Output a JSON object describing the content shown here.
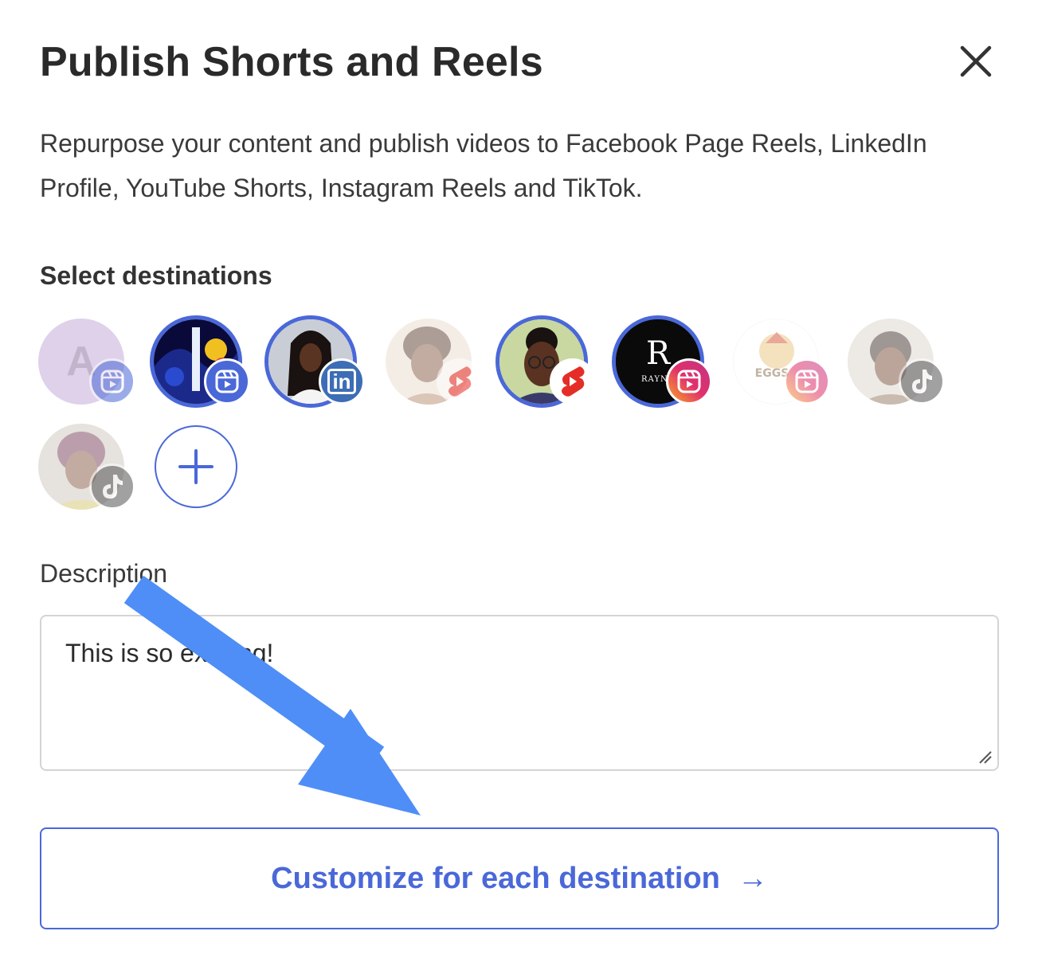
{
  "dialog": {
    "title": "Publish Shorts and Reels",
    "subtitle": "Repurpose your content and publish videos to Facebook Page Reels, LinkedIn Profile, YouTube Shorts, Instagram Reels and TikTok.",
    "destinations_label": "Select destinations",
    "description_label": "Description",
    "description_value": "This is so exciting!",
    "customize_label": "Customize for each destination",
    "customize_arrow": "→"
  },
  "destinations": [
    {
      "platform": "facebook-reels",
      "selected": false,
      "avatar_letter": "A"
    },
    {
      "platform": "facebook-reels",
      "selected": true
    },
    {
      "platform": "linkedin",
      "selected": true,
      "badge_text": "in"
    },
    {
      "platform": "youtube-shorts",
      "selected": false
    },
    {
      "platform": "youtube-shorts",
      "selected": true
    },
    {
      "platform": "instagram-reels",
      "selected": true,
      "avatar_text": "RAYNE"
    },
    {
      "platform": "instagram-reels",
      "selected": false,
      "avatar_text": "A&E EGGS"
    },
    {
      "platform": "tiktok",
      "selected": false
    },
    {
      "platform": "tiktok",
      "selected": false
    }
  ],
  "colors": {
    "accent": "#4a68d8",
    "facebook": "#4a68d8",
    "linkedin": "#3d6db5",
    "youtube": "#e52d27",
    "tiktok": "#555555",
    "annotation_arrow": "#4f8ef7"
  }
}
